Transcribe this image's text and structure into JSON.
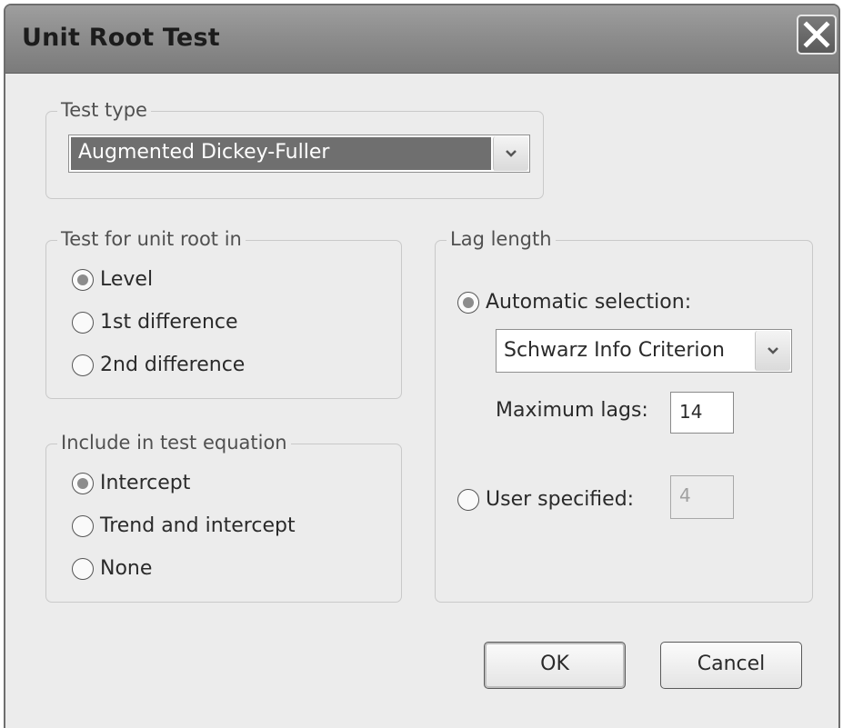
{
  "window": {
    "title": "Unit Root Test",
    "close_icon": "close-x-icon"
  },
  "test_type": {
    "legend": "Test type",
    "selected": "Augmented Dickey-Fuller"
  },
  "unit_root_in": {
    "legend": "Test for unit root in",
    "options": [
      "Level",
      "1st difference",
      "2nd difference"
    ],
    "selected_index": 0
  },
  "include_in_equation": {
    "legend": "Include in test equation",
    "options": [
      "Intercept",
      "Trend and intercept",
      "None"
    ],
    "selected_index": 0
  },
  "lag_length": {
    "legend": "Lag length",
    "automatic_label": "Automatic selection:",
    "criterion_selected": "Schwarz Info Criterion",
    "max_lags_label": "Maximum lags:",
    "max_lags_value": "14",
    "user_specified_label": "User specified:",
    "user_specified_value": "4",
    "selected": "automatic"
  },
  "buttons": {
    "ok": "OK",
    "cancel": "Cancel"
  }
}
